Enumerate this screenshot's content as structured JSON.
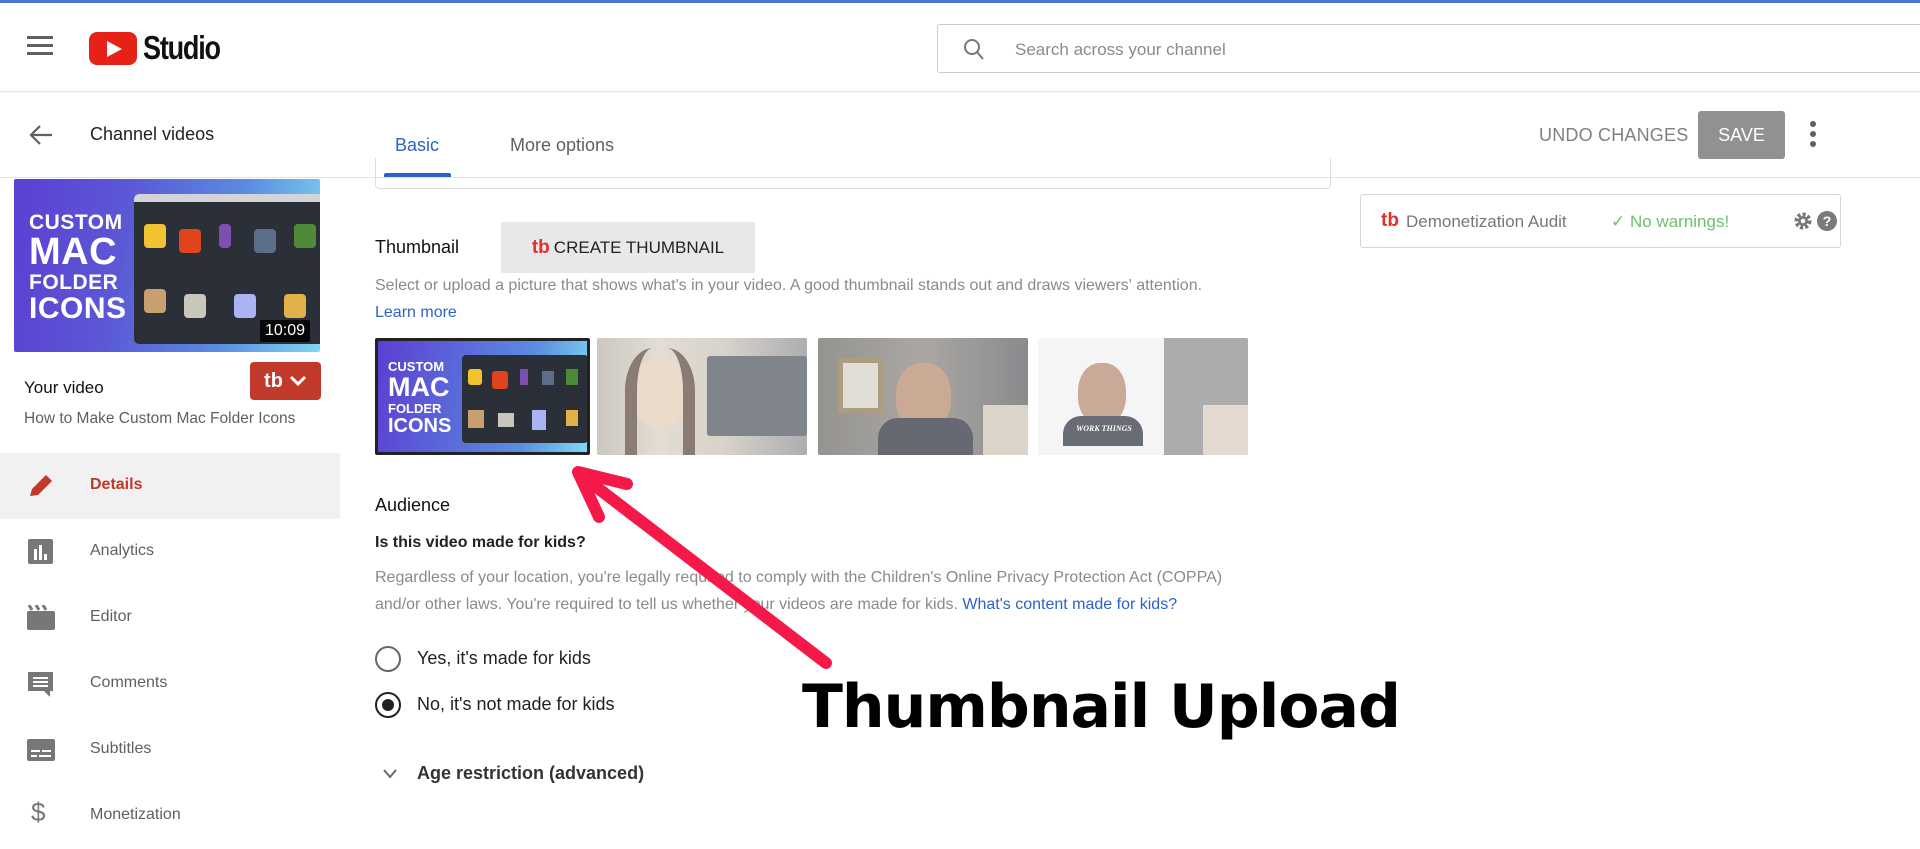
{
  "header": {
    "app_title": "Studio",
    "search_placeholder": "Search across your channel"
  },
  "subbar": {
    "back_label": "Channel videos",
    "tabs": [
      {
        "label": "Basic",
        "active": true
      },
      {
        "label": "More options",
        "active": false
      }
    ],
    "undo_label": "UNDO CHANGES",
    "save_label": "SAVE"
  },
  "sidebar": {
    "video": {
      "thumb_text": [
        "CUSTOM",
        "MAC",
        "FOLDER",
        "ICONS"
      ],
      "duration": "10:09",
      "heading": "Your video",
      "title": "How to Make Custom Mac Folder Icons"
    },
    "tubebuddy_button": "tb",
    "items": [
      {
        "label": "Details",
        "icon": "pencil-icon",
        "active": true
      },
      {
        "label": "Analytics",
        "icon": "bar-chart-icon",
        "active": false
      },
      {
        "label": "Editor",
        "icon": "clapperboard-icon",
        "active": false
      },
      {
        "label": "Comments",
        "icon": "comment-icon",
        "active": false
      },
      {
        "label": "Subtitles",
        "icon": "subtitles-icon",
        "active": false
      },
      {
        "label": "Monetization",
        "icon": "dollar-icon",
        "active": false
      }
    ]
  },
  "thumbnail": {
    "label": "Thumbnail",
    "create_button": "CREATE THUMBNAIL",
    "create_button_brand": "tb",
    "description": "Select or upload a picture that shows what's in your video. A good thumbnail stands out and draws viewers' attention.",
    "learn_more": "Learn more",
    "options": [
      {
        "name": "custom-thumbnail",
        "selected": true
      },
      {
        "name": "auto-thumbnail-1",
        "selected": false
      },
      {
        "name": "auto-thumbnail-2",
        "selected": false
      },
      {
        "name": "auto-thumbnail-3",
        "selected": false
      }
    ],
    "auto_thumb_3_caption": "WORK THINGS"
  },
  "audience": {
    "label": "Audience",
    "question": "Is this video made for kids?",
    "paragraph_1": "Regardless of your location, you're legally required to comply with the Children's Online Privacy Protection Act (COPPA)",
    "paragraph_2": "and/or other laws. You're required to tell us whether your videos are made for kids.",
    "link": "What's content made for kids?",
    "options": [
      {
        "label": "Yes, it's made for kids",
        "checked": false
      },
      {
        "label": "No, it's not made for kids",
        "checked": true
      }
    ],
    "age_restriction": "Age restriction (advanced)"
  },
  "audit": {
    "brand": "tb",
    "name": "Demonetization Audit",
    "status": "✓ No warnings!",
    "status_color": "#6cc06c",
    "help": "?"
  },
  "annotation": {
    "text": "Thumbnail Upload",
    "arrow_color": "#f5194a"
  },
  "colors": {
    "accent_blue": "#2c62c9",
    "youtube_red": "#e62117",
    "tubebuddy_red": "#c0392b"
  }
}
